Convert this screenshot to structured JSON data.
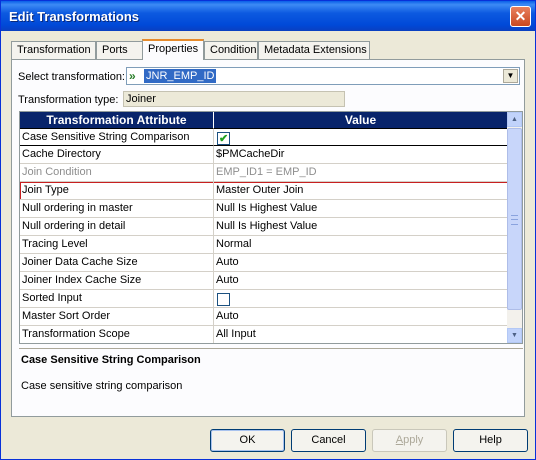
{
  "window": {
    "title": "Edit Transformations",
    "close_symbol": "✕"
  },
  "tabs": [
    {
      "label": "Transformation"
    },
    {
      "label": "Ports"
    },
    {
      "label": "Properties",
      "active": true
    },
    {
      "label": "Condition"
    },
    {
      "label": "Metadata Extensions"
    }
  ],
  "form": {
    "select_label": "Select transformation:",
    "select_value": "JNR_EMP_ID",
    "type_label": "Transformation type:",
    "type_value": "Joiner"
  },
  "grid": {
    "headers": [
      "Transformation Attribute",
      "Value"
    ],
    "rows": [
      {
        "attr": "Case Sensitive String Comparison",
        "value": "",
        "checkbox": true,
        "checked": true
      },
      {
        "attr": "Cache Directory",
        "value": "$PMCacheDir"
      },
      {
        "attr": "Join Condition",
        "value": "EMP_ID1 = EMP_ID",
        "disabled": true
      },
      {
        "attr": "Join Type",
        "value": "Master Outer Join",
        "highlight": true
      },
      {
        "attr": "Null ordering in master",
        "value": "Null Is Highest Value"
      },
      {
        "attr": "Null ordering in detail",
        "value": "Null Is Highest Value"
      },
      {
        "attr": "Tracing Level",
        "value": "Normal"
      },
      {
        "attr": "Joiner Data Cache Size",
        "value": "Auto"
      },
      {
        "attr": "Joiner Index Cache Size",
        "value": "Auto"
      },
      {
        "attr": "Sorted Input",
        "value": "",
        "checkbox": true,
        "checked": false
      },
      {
        "attr": "Master Sort Order",
        "value": "Auto"
      },
      {
        "attr": "Transformation Scope",
        "value": "All Input"
      }
    ]
  },
  "description": {
    "title": "Case Sensitive String Comparison",
    "text": "Case sensitive string comparison"
  },
  "buttons": {
    "ok": "OK",
    "cancel": "Cancel",
    "apply": "Apply",
    "help": "Help"
  },
  "icons": {
    "close": "close-icon",
    "transformation": "joiner-icon",
    "dropdown": "chevron-down-icon",
    "scroll_up": "scroll-up-icon",
    "scroll_down": "scroll-down-icon",
    "check": "checkmark-icon"
  },
  "colors": {
    "title_bar": "#0054e3",
    "grid_header": "#08246b",
    "selection": "#316ac5",
    "highlight_border": "#c82020"
  }
}
